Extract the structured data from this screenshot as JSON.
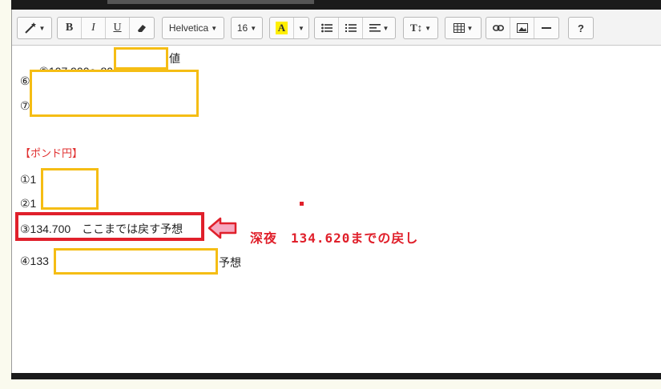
{
  "toolbar": {
    "font_name": "Helvetica",
    "font_size": "16",
    "bold_label": "B",
    "italic_label": "I",
    "underline_label": "U",
    "highlight_label": "A",
    "text_height_label": "T↕",
    "help_label": "?",
    "icons": [
      "magic-wand-icon",
      "eraser-icon",
      "bullet-list-icon",
      "numbered-list-icon",
      "align-icon",
      "table-icon",
      "link-icon",
      "image-icon",
      "horizontal-rule-icon"
    ]
  },
  "content": {
    "line1_text": "⑤107.900～800",
    "line1_suffix": "値",
    "line2_text": "⑥",
    "line3_text": "⑦",
    "heading": "【ポンド円】",
    "line5_text": "①1",
    "line6_text": "②1",
    "line7_text": "③134.700　ここまでは戻す予想",
    "line8_text": "④133",
    "line8_suffix": "予想"
  },
  "annotation": {
    "note": "深夜　134.620までの戻し",
    "colors": {
      "highlight_box": "#f5bd14",
      "emphasis_box": "#e0202b",
      "arrow_fill": "#f6a9c0"
    }
  }
}
